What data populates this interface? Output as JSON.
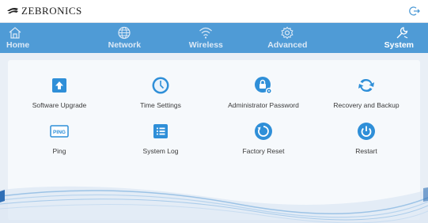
{
  "brand": {
    "name": "ZEBRONICS"
  },
  "header": {
    "logout_icon": "logout-icon"
  },
  "nav": {
    "items": [
      {
        "label": "Home",
        "icon": "home-icon"
      },
      {
        "label": "Network",
        "icon": "globe-icon"
      },
      {
        "label": "Wireless",
        "icon": "wifi-icon"
      },
      {
        "label": "Advanced",
        "icon": "gear-icon"
      },
      {
        "label": "System",
        "icon": "wrench-icon",
        "active": true
      }
    ]
  },
  "tools": {
    "items": [
      {
        "label": "Software Upgrade",
        "icon": "upload-icon"
      },
      {
        "label": "Time Settings",
        "icon": "clock-icon"
      },
      {
        "label": "Administrator Password",
        "icon": "lock-gear-icon"
      },
      {
        "label": "Recovery and Backup",
        "icon": "recovery-icon"
      },
      {
        "label": "Ping",
        "icon": "ping-icon",
        "badge": "PING"
      },
      {
        "label": "System Log",
        "icon": "log-icon"
      },
      {
        "label": "Factory Reset",
        "icon": "reset-icon"
      },
      {
        "label": "Restart",
        "icon": "power-icon"
      }
    ]
  },
  "colors": {
    "nav_bg": "#4f9bd6",
    "accent": "#2f8fd8",
    "page_bg": "#e9eff6"
  }
}
